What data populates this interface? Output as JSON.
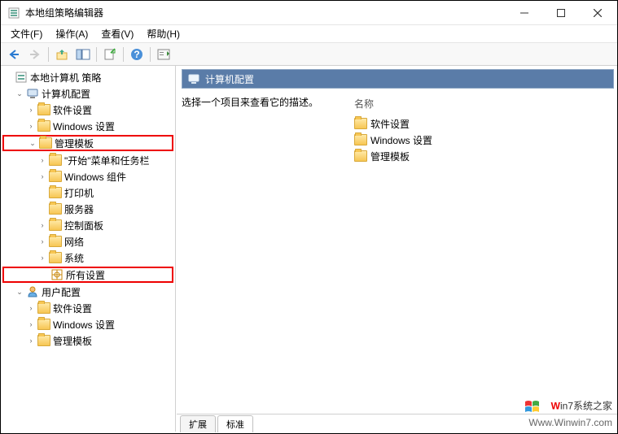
{
  "title": "本地组策略编辑器",
  "menu": {
    "file": "文件(F)",
    "action": "操作(A)",
    "view": "查看(V)",
    "help": "帮助(H)"
  },
  "tree": {
    "root": "本地计算机 策略",
    "computer_config": "计算机配置",
    "software_settings": "软件设置",
    "windows_settings": "Windows 设置",
    "admin_templates": "管理模板",
    "start_taskbar": "\"开始\"菜单和任务栏",
    "windows_components": "Windows 组件",
    "printers": "打印机",
    "server": "服务器",
    "control_panel": "控制面板",
    "network": "网络",
    "system": "系统",
    "all_settings": "所有设置",
    "user_config": "用户配置",
    "u_software_settings": "软件设置",
    "u_windows_settings": "Windows 设置",
    "u_admin_templates": "管理模板"
  },
  "main": {
    "header": "计算机配置",
    "description": "选择一个项目来查看它的描述。",
    "name_header": "名称",
    "items": {
      "software": "软件设置",
      "windows": "Windows 设置",
      "admin": "管理模板"
    }
  },
  "tabs": {
    "extended": "扩展",
    "standard": "标准"
  },
  "watermark": {
    "line1_prefix": "W",
    "line1_rest": "in7系统之家",
    "line2": "Www.Winwin7.com"
  }
}
